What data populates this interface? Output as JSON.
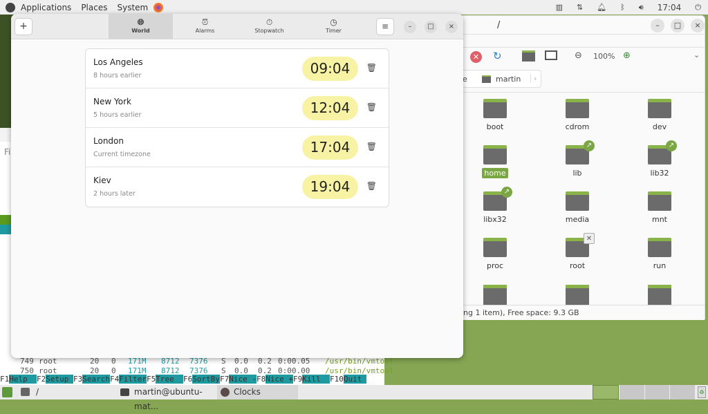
{
  "top_panel": {
    "menus": [
      "Applications",
      "Places",
      "System"
    ],
    "clock": "17:04"
  },
  "terminal": {
    "partial_menu": "Fi",
    "rows": [
      {
        "pid": "749",
        "user": "root",
        "pri": "20",
        "ni": "0",
        "virt": "171M",
        "res": "8712",
        "shr": "7376",
        "s": "S",
        "cpu": "0.0",
        "mem": "0.2",
        "time": "0:00.05",
        "cmd": "/usr/bin/vmtool"
      },
      {
        "pid": "750",
        "user": "root",
        "pri": "20",
        "ni": "0",
        "virt": "171M",
        "res": "8712",
        "shr": "7376",
        "s": "S",
        "cpu": "0.0",
        "mem": "0.2",
        "time": "0:00.00",
        "cmd": "/usr/bin/vmtool"
      }
    ],
    "fkeys": [
      {
        "k": "F1",
        "l": "Help  "
      },
      {
        "k": "F2",
        "l": "Setup "
      },
      {
        "k": "F3",
        "l": "Search"
      },
      {
        "k": "F4",
        "l": "Filter"
      },
      {
        "k": "F5",
        "l": "Tree  "
      },
      {
        "k": "F6",
        "l": "SortBy"
      },
      {
        "k": "F7",
        "l": "Nice -"
      },
      {
        "k": "F8",
        "l": "Nice +"
      },
      {
        "k": "F9",
        "l": "Kill  "
      },
      {
        "k": "F10",
        "l": "Quit "
      }
    ]
  },
  "file_manager": {
    "title": "/",
    "zoom": "100%",
    "breadcrumb_partial": "e",
    "breadcrumb": "martin",
    "items": [
      {
        "name": "boot"
      },
      {
        "name": "cdrom"
      },
      {
        "name": "dev"
      },
      {
        "name": "home",
        "selected": true
      },
      {
        "name": "lib",
        "link": true
      },
      {
        "name": "lib32",
        "link": true
      },
      {
        "name": "libx32",
        "link": true
      },
      {
        "name": "media"
      },
      {
        "name": "mnt"
      },
      {
        "name": "proc"
      },
      {
        "name": "root",
        "locked": true
      },
      {
        "name": "run"
      }
    ],
    "status": "ing 1 item), Free space: 9.3 GB"
  },
  "clocks": {
    "tabs": [
      {
        "label": "World",
        "icon": "globe-icon",
        "active": true
      },
      {
        "label": "Alarms",
        "icon": "alarm-icon"
      },
      {
        "label": "Stopwatch",
        "icon": "stopwatch-icon"
      },
      {
        "label": "Timer",
        "icon": "timer-icon"
      }
    ],
    "cities": [
      {
        "name": "Los Angeles",
        "diff": "8 hours earlier",
        "time": "09:04"
      },
      {
        "name": "New York",
        "diff": "5 hours earlier",
        "time": "12:04"
      },
      {
        "name": "London",
        "diff": "Current timezone",
        "time": "17:04"
      },
      {
        "name": "Kiev",
        "diff": "2 hours later",
        "time": "19:04"
      }
    ]
  },
  "bottom_panel": {
    "tasks": [
      "/",
      "martin@ubuntu-mat...",
      "Clocks"
    ]
  },
  "colors": {
    "desktop": "#86a653",
    "time_pill": "#f8f3a4",
    "folder_accent": "#8ab34a",
    "htop_key": "#1e9aa0"
  }
}
